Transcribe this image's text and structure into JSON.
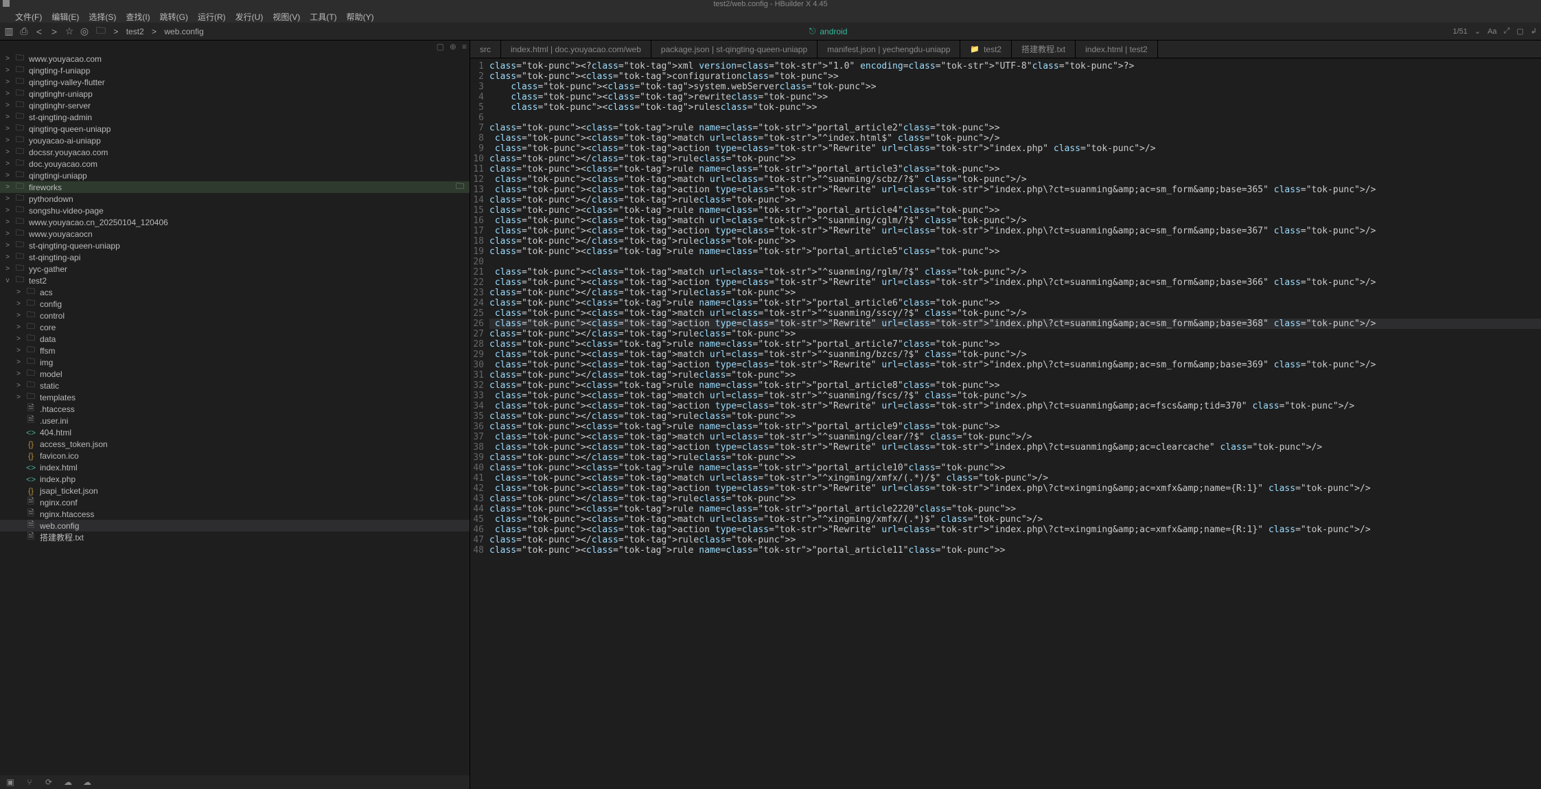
{
  "title": "test2/web.config - HBuilder X 4.45",
  "menu": [
    "文件(F)",
    "编辑(E)",
    "选择(S)",
    "查找(I)",
    "跳转(G)",
    "运行(R)",
    "发行(U)",
    "视图(V)",
    "工具(T)",
    "帮助(Y)"
  ],
  "toolbar": {
    "crumbs": [
      "test2",
      "web.config"
    ],
    "device_icon": "⎋",
    "device": "android",
    "ratio": "1/51"
  },
  "sidebar_mini": [
    "▢",
    "⊕",
    "≡"
  ],
  "tree": [
    {
      "d": 0,
      "k": "fold",
      "chev": ">",
      "label": "www.youyacao.com"
    },
    {
      "d": 0,
      "k": "fold",
      "chev": ">",
      "label": "qingting-f-uniapp"
    },
    {
      "d": 0,
      "k": "fold",
      "chev": ">",
      "label": "qingting-valley-flutter"
    },
    {
      "d": 0,
      "k": "fold",
      "chev": ">",
      "label": "qingtinghr-uniapp"
    },
    {
      "d": 0,
      "k": "fold",
      "chev": ">",
      "label": "qingtinghr-server"
    },
    {
      "d": 0,
      "k": "fold",
      "chev": ">",
      "label": "st-qingting-admin"
    },
    {
      "d": 0,
      "k": "fold",
      "chev": ">",
      "label": "qingting-queen-uniapp"
    },
    {
      "d": 0,
      "k": "fold",
      "chev": ">",
      "label": "youyacao-ai-uniapp"
    },
    {
      "d": 0,
      "k": "fold",
      "chev": ">",
      "label": "docssr.youyacao.com"
    },
    {
      "d": 0,
      "k": "fold",
      "chev": ">",
      "label": "doc.youyacao.com"
    },
    {
      "d": 0,
      "k": "fold",
      "chev": ">",
      "label": "qingtingi-uniapp"
    },
    {
      "d": 0,
      "k": "fold",
      "chev": ">",
      "label": "fireworks",
      "cls": "sel"
    },
    {
      "d": 0,
      "k": "fold",
      "chev": ">",
      "label": "pythondown"
    },
    {
      "d": 0,
      "k": "fold",
      "chev": ">",
      "label": "songshu-video-page"
    },
    {
      "d": 0,
      "k": "fold",
      "chev": ">",
      "label": "www.youyacao.cn_20250104_120406"
    },
    {
      "d": 0,
      "k": "fold",
      "chev": ">",
      "label": "www.youyacaocn"
    },
    {
      "d": 0,
      "k": "fold",
      "chev": ">",
      "label": "st-qingting-queen-uniapp"
    },
    {
      "d": 0,
      "k": "fold",
      "chev": ">",
      "label": "st-qingting-api"
    },
    {
      "d": 0,
      "k": "fold",
      "chev": ">",
      "label": "yyc-gather"
    },
    {
      "d": 0,
      "k": "fold",
      "chev": "v",
      "label": "test2"
    },
    {
      "d": 1,
      "k": "fold",
      "chev": ">",
      "label": "acs"
    },
    {
      "d": 1,
      "k": "fold",
      "chev": ">",
      "label": "config"
    },
    {
      "d": 1,
      "k": "fold",
      "chev": ">",
      "label": "control"
    },
    {
      "d": 1,
      "k": "fold",
      "chev": ">",
      "label": "core"
    },
    {
      "d": 1,
      "k": "fold",
      "chev": ">",
      "label": "data"
    },
    {
      "d": 1,
      "k": "fold",
      "chev": ">",
      "label": "ffsm"
    },
    {
      "d": 1,
      "k": "fold",
      "chev": ">",
      "label": "img"
    },
    {
      "d": 1,
      "k": "fold",
      "chev": ">",
      "label": "model"
    },
    {
      "d": 1,
      "k": "fold",
      "chev": ">",
      "label": "static"
    },
    {
      "d": 1,
      "k": "fold",
      "chev": ">",
      "label": "templates"
    },
    {
      "d": 1,
      "k": "doc",
      "chev": "",
      "label": ".htaccess"
    },
    {
      "d": 1,
      "k": "doc",
      "chev": "",
      "label": ".user.ini"
    },
    {
      "d": 1,
      "k": "angles",
      "chev": "",
      "label": "404.html"
    },
    {
      "d": 1,
      "k": "brackets",
      "chev": "",
      "label": "access_token.json"
    },
    {
      "d": 1,
      "k": "brackets",
      "chev": "",
      "label": "favicon.ico"
    },
    {
      "d": 1,
      "k": "angles",
      "chev": "",
      "label": "index.html"
    },
    {
      "d": 1,
      "k": "angles",
      "chev": "",
      "label": "index.php"
    },
    {
      "d": 1,
      "k": "brackets",
      "chev": "",
      "label": "jsapi_ticket.json"
    },
    {
      "d": 1,
      "k": "doc",
      "chev": "",
      "label": "nginx.conf"
    },
    {
      "d": 1,
      "k": "doc",
      "chev": "",
      "label": "nginx.htaccess"
    },
    {
      "d": 1,
      "k": "doc",
      "chev": "",
      "label": "web.config",
      "cls": "sel2"
    },
    {
      "d": 1,
      "k": "doc",
      "chev": "",
      "label": "搭建教程.txt"
    }
  ],
  "sidebar_bottom": [
    "▣",
    "⑂",
    "⟳",
    "☁",
    "☁"
  ],
  "tabs": [
    {
      "icon": "",
      "label": "src"
    },
    {
      "icon": "",
      "label": "index.html | doc.youyacao.com/web"
    },
    {
      "icon": "",
      "label": "package.json | st-qingting-queen-uniapp"
    },
    {
      "icon": "",
      "label": "manifest.json | yechengdu-uniapp"
    },
    {
      "icon": "📁",
      "label": "test2"
    },
    {
      "icon": "",
      "label": "搭建教程.txt"
    },
    {
      "icon": "",
      "label": "index.html | test2"
    }
  ],
  "code_lines": [
    "<?xml version=\"1.0\" encoding=\"UTF-8\"?>",
    "<configuration>",
    "    <system.webServer>",
    "    <rewrite>",
    "    <rules>",
    "",
    "<rule name=\"portal_article2\">",
    " <match url=\"^index.html$\" />",
    " <action type=\"Rewrite\" url=\"index.php\" />",
    "</rule>",
    "<rule name=\"portal_article3\">",
    " <match url=\"^suanming/scbz/?$\" />",
    " <action type=\"Rewrite\" url=\"index.php\\?ct=suanming&amp;ac=sm_form&amp;base=365\" />",
    "</rule>",
    "<rule name=\"portal_article4\">",
    " <match url=\"^suanming/cglm/?$\" />",
    " <action type=\"Rewrite\" url=\"index.php\\?ct=suanming&amp;ac=sm_form&amp;base=367\" />",
    "</rule>",
    "<rule name=\"portal_article5\">",
    "",
    " <match url=\"^suanming/rglm/?$\" />",
    " <action type=\"Rewrite\" url=\"index.php\\?ct=suanming&amp;ac=sm_form&amp;base=366\" />",
    "</rule>",
    "<rule name=\"portal_article6\">",
    " <match url=\"^suanming/sscy/?$\" />",
    " <action type=\"Rewrite\" url=\"index.php\\?ct=suanming&amp;ac=sm_form&amp;base=368\" />",
    "</rule>",
    "<rule name=\"portal_article7\">",
    " <match url=\"^suanming/bzcs/?$\" />",
    " <action type=\"Rewrite\" url=\"index.php\\?ct=suanming&amp;ac=sm_form&amp;base=369\" />",
    "</rule>",
    "<rule name=\"portal_article8\">",
    " <match url=\"^suanming/fscs/?$\" />",
    " <action type=\"Rewrite\" url=\"index.php\\?ct=suanming&amp;ac=fscs&amp;tid=370\" />",
    "</rule>",
    "<rule name=\"portal_article9\">",
    " <match url=\"^suanming/clear/?$\" />",
    " <action type=\"Rewrite\" url=\"index.php\\?ct=suanming&amp;ac=clearcache\" />",
    "</rule>",
    "<rule name=\"portal_article10\">",
    " <match url=\"^xingming/xmfx/(.*)/$\" />",
    " <action type=\"Rewrite\" url=\"index.php\\?ct=xingming&amp;ac=xmfx&amp;name={R:1}\" />",
    "</rule>",
    "<rule name=\"portal_article2220\">",
    " <match url=\"^xingming/xmfx/(.*)$\" />",
    " <action type=\"Rewrite\" url=\"index.php\\?ct=xingming&amp;ac=xmfx&amp;name={R:1}\" />",
    "</rule>",
    "<rule name=\"portal_article11\">"
  ],
  "current_line_index": 25
}
